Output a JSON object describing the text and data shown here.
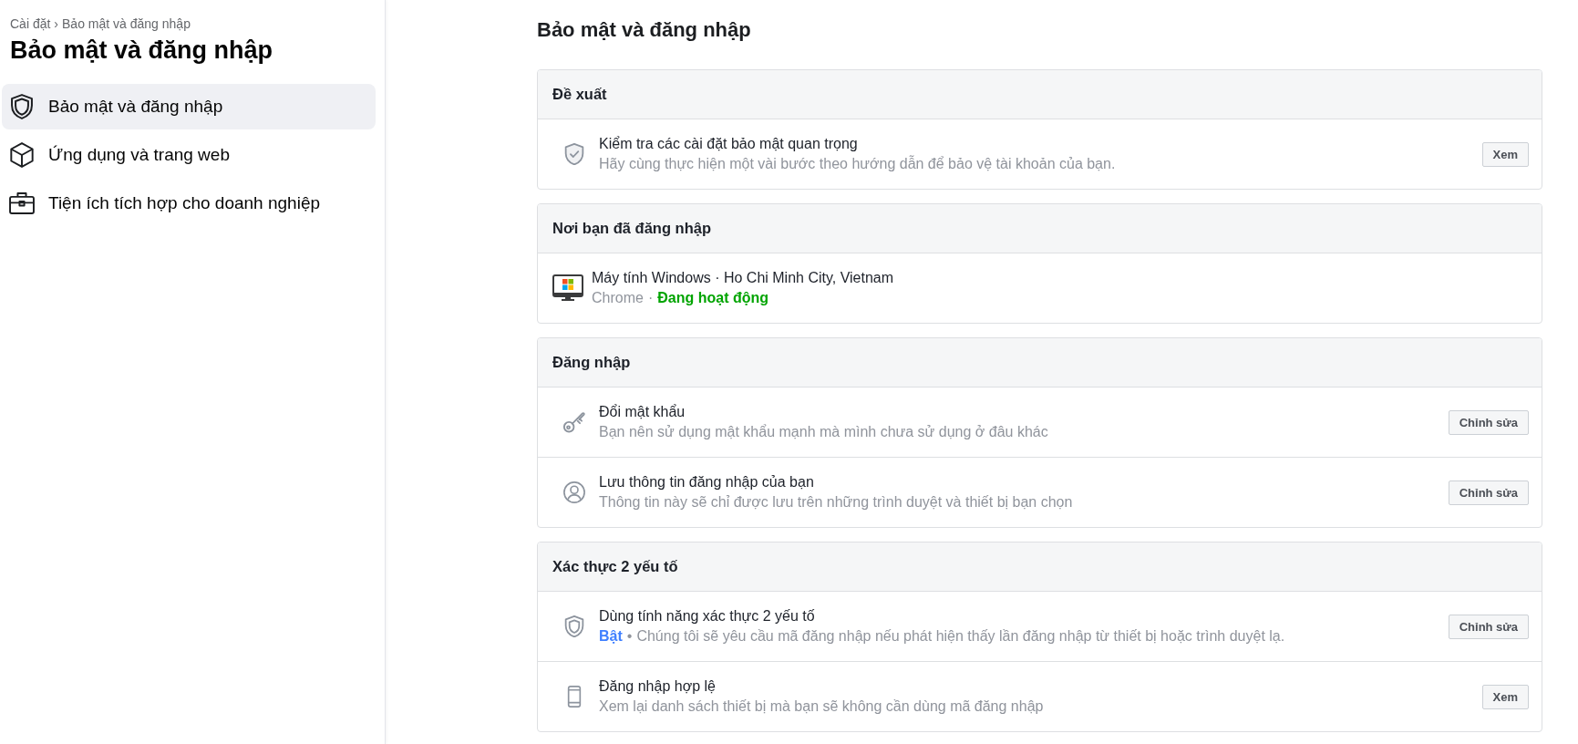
{
  "breadcrumb": {
    "items": [
      "Cài đặt",
      "Bảo mật và đăng nhập"
    ],
    "separator": "›"
  },
  "sidebar": {
    "title": "Bảo mật và đăng nhập",
    "items": [
      {
        "label": "Bảo mật và đăng nhập",
        "selected": true
      },
      {
        "label": "Ứng dụng và trang web",
        "selected": false
      },
      {
        "label": "Tiện ích tích hợp cho doanh nghiệp",
        "selected": false
      }
    ]
  },
  "main": {
    "title": "Bảo mật và đăng nhập",
    "sections": [
      {
        "title": "Đề xuất",
        "rows": [
          {
            "kind": "setting",
            "title": "Kiểm tra các cài đặt bảo mật quan trọng",
            "description": "Hãy cùng thực hiện một vài bước theo hướng dẫn để bảo vệ tài khoản của bạn.",
            "button": "Xem"
          }
        ]
      },
      {
        "title": "Nơi bạn đã đăng nhập",
        "rows": [
          {
            "kind": "session",
            "title": "Máy tính Windows · Ho Chi Minh City, Vietnam",
            "browser": "Chrome",
            "separator": "·",
            "status": "Đang hoạt động",
            "active": true
          }
        ]
      },
      {
        "title": "Đăng nhập",
        "rows": [
          {
            "kind": "setting",
            "title": "Đổi mật khẩu",
            "description": "Bạn nên sử dụng mật khẩu mạnh mà mình chưa sử dụng ở đâu khác",
            "button": "Chỉnh sửa"
          },
          {
            "kind": "setting",
            "title": "Lưu thông tin đăng nhập của bạn",
            "description": "Thông tin này sẽ chỉ được lưu trên những trình duyệt và thiết bị bạn chọn",
            "button": "Chỉnh sửa"
          }
        ]
      },
      {
        "title": "Xác thực 2 yếu tố",
        "rows": [
          {
            "kind": "setting",
            "title": "Dùng tính năng xác thực 2 yếu tố",
            "status": "Bật",
            "on": true,
            "separator": "•",
            "description": "Chúng tôi sẽ yêu cầu mã đăng nhập nếu phát hiện thấy lần đăng nhập từ thiết bị hoặc trình duyệt lạ.",
            "button": "Chỉnh sửa"
          },
          {
            "kind": "setting",
            "title": "Đăng nhập hợp lệ",
            "description": "Xem lại danh sách thiết bị mà bạn sẽ không cần dùng mã đăng nhập",
            "button": "Xem"
          }
        ]
      }
    ]
  }
}
